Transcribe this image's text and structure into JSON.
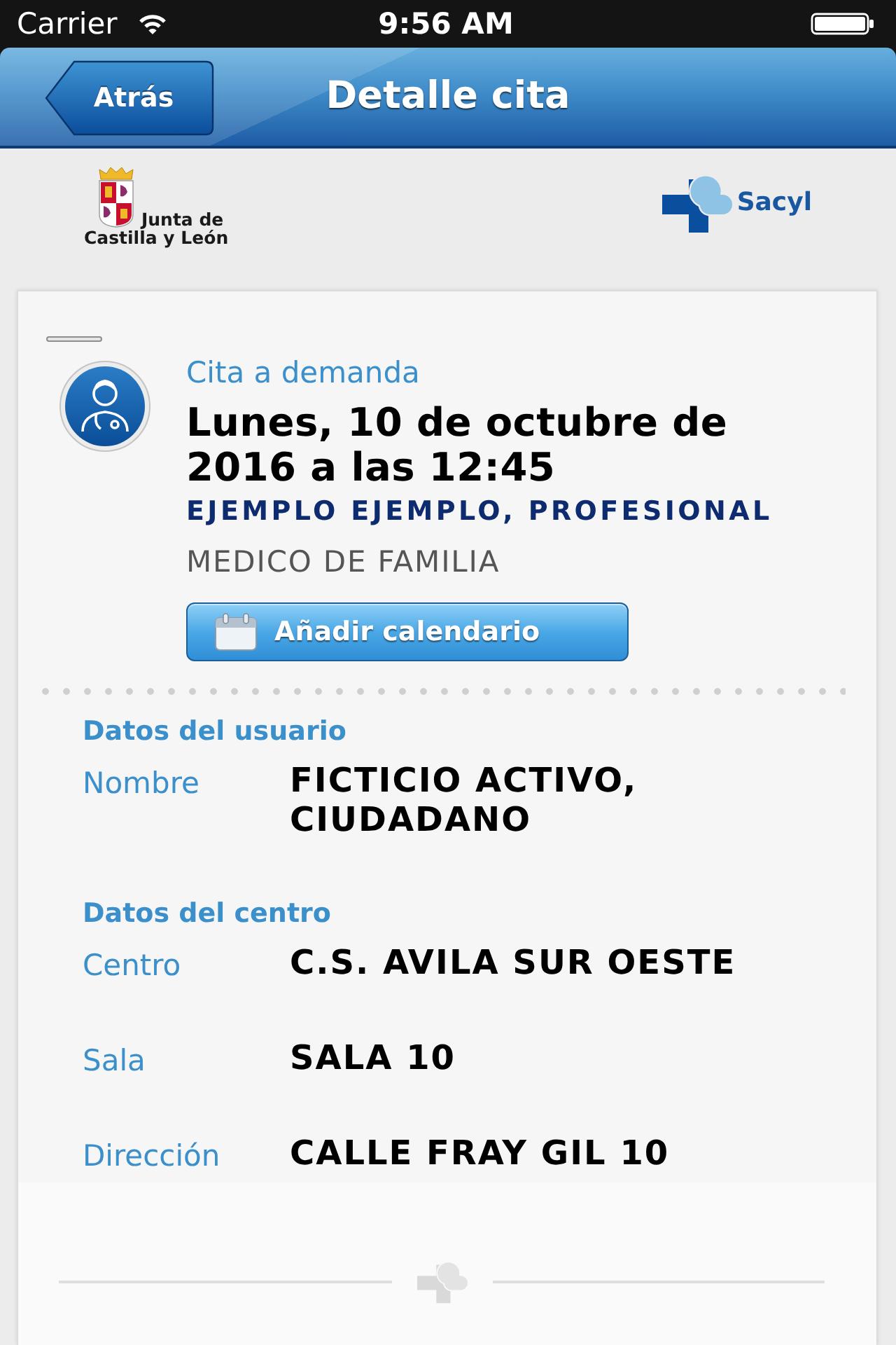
{
  "status_bar": {
    "carrier": "Carrier",
    "time": "9:56 AM"
  },
  "nav_bar": {
    "back_button": "Atrás",
    "title": "Detalle cita"
  },
  "header": {
    "junta_logo": [
      "Junta de",
      "Castilla y León"
    ],
    "sacyl_logo": "Sacyl"
  },
  "appointment": {
    "type": "Cita a demanda",
    "date_time": "Lunes, 10 de octubre de 2016 a las 12:45",
    "professional": "EJEMPLO EJEMPLO, PROFESIONAL",
    "specialty": "MEDICO DE FAMILIA",
    "calendar_button": "Añadir calendario"
  },
  "sections": [
    {
      "title": "Datos del usuario",
      "fields": [
        {
          "label": "Nombre",
          "value": "FICTICIO ACTIVO, CIUDADANO"
        }
      ]
    },
    {
      "title": "Datos del centro",
      "fields": [
        {
          "label": "Centro",
          "value": "C.S. AVILA SUR OESTE"
        },
        {
          "label": "Sala",
          "value": "SALA 10"
        },
        {
          "label": "Dirección",
          "value": "CALLE FRAY GIL 10"
        }
      ]
    }
  ]
}
